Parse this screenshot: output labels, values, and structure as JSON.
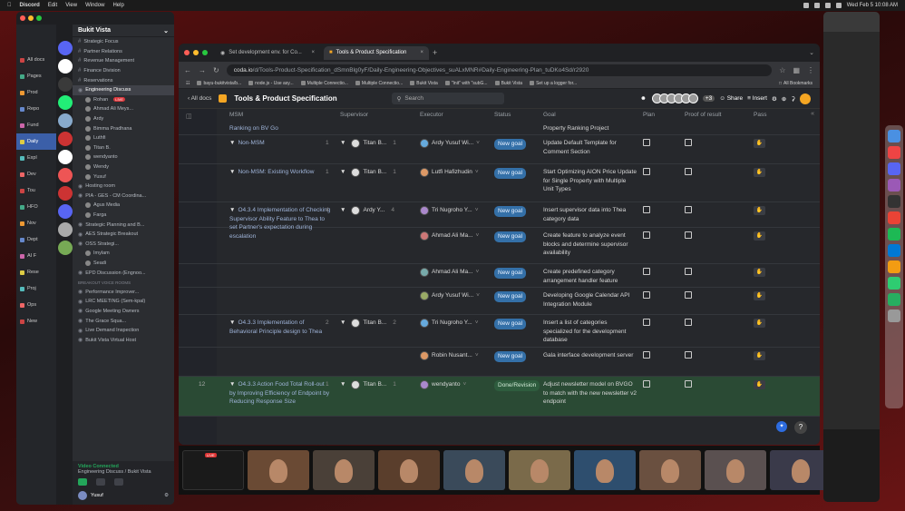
{
  "menubar": {
    "app": "Discord",
    "items": [
      "Edit",
      "View",
      "Window",
      "Help"
    ],
    "clock": "Wed Feb 5 10:08 AM"
  },
  "discord": {
    "server_name": "Bukit Vista",
    "docnav": [
      "All docs",
      "Pages",
      "Prod",
      "Repo",
      "Fund",
      "Daily",
      "Expl",
      "Dev",
      "Tou",
      "HFO",
      "Nov",
      "Dept",
      "AI F",
      "Rese",
      "Proj",
      "Ops",
      "New"
    ],
    "channels": [
      {
        "name": "Strategic Focus",
        "kind": "text"
      },
      {
        "name": "Partner Relations",
        "kind": "text"
      },
      {
        "name": "Revenue Management",
        "kind": "text"
      },
      {
        "name": "Finance Division",
        "kind": "text"
      },
      {
        "name": "Reservations",
        "kind": "text"
      },
      {
        "name": "Engineering Discuss",
        "kind": "voice",
        "active": true
      },
      {
        "name": "Rohan",
        "kind": "user",
        "badge": "LIVE"
      },
      {
        "name": "Ahmad Ali Meys...",
        "kind": "user"
      },
      {
        "name": "Ardy",
        "kind": "user"
      },
      {
        "name": "Bimma Pradhana",
        "kind": "user"
      },
      {
        "name": "Luthfi",
        "kind": "user"
      },
      {
        "name": "Titan B.",
        "kind": "user"
      },
      {
        "name": "wendyanto",
        "kind": "user"
      },
      {
        "name": "Wendy",
        "kind": "user"
      },
      {
        "name": "Yusuf",
        "kind": "user"
      },
      {
        "name": "Hosting room",
        "kind": "voice"
      },
      {
        "name": "PIA - GES - CM Coordina...",
        "kind": "voice"
      },
      {
        "name": "Agus Media",
        "kind": "user"
      },
      {
        "name": "Farga",
        "kind": "user"
      },
      {
        "name": "Strategic Planning and B...",
        "kind": "voice"
      },
      {
        "name": "AES Strategic Breakout",
        "kind": "voice"
      },
      {
        "name": "OSS Strategi...",
        "kind": "voice"
      },
      {
        "name": "Imylam",
        "kind": "user"
      },
      {
        "name": "Seadi",
        "kind": "user"
      },
      {
        "name": "EPD Discussion (Engnoo...",
        "kind": "voice"
      },
      {
        "name": "BREAKOUT VOICE ROOMS",
        "kind": "category"
      },
      {
        "name": "Performance Improver...",
        "kind": "voice"
      },
      {
        "name": "LRC MEETING (Sem-kpal)",
        "kind": "voice"
      },
      {
        "name": "Google Meeting Owners",
        "kind": "voice"
      },
      {
        "name": "The Grace Squa...",
        "kind": "voice"
      },
      {
        "name": "Live Demand Inspection",
        "kind": "voice"
      },
      {
        "name": "Bukit Vista Virtual Host",
        "kind": "voice"
      }
    ],
    "voice_status": "Video Connected",
    "voice_sub": "Engineering Discuss / Bukit Vista",
    "user": "Yusuf"
  },
  "browser": {
    "tabs": [
      {
        "title": "Set development env. for Co...",
        "active": false
      },
      {
        "title": "Tools & Product Specification",
        "active": true
      }
    ],
    "url_host": "coda.io",
    "url_path": "/d/Tools-Product-Specification_dSmnBlg0yF/Daily-Engineering-Objectives_suALxMNR#Daily-Engineering-Plan_tuDKo4Sd/r2920",
    "bookmarks": [
      "bayu-bukitvista/b...",
      "node.js - Use asy...",
      "Multiple Connectio...",
      "Multiple Connectio...",
      "Bukit Vista",
      "\"Init\" with \"subG...",
      "Bukit Vista",
      "Set up a logger for..."
    ],
    "all_bookmarks": "All Bookmarks"
  },
  "coda": {
    "all_docs": "All docs",
    "doc_title": "Tools & Product Specification",
    "search_placeholder": "Search",
    "share_label": "Share",
    "insert_label": "Insert",
    "extra_count": "+3",
    "columns": [
      "MSM",
      "Supervisor",
      "Executor",
      "Status",
      "Goal",
      "Plan",
      "Proof of result",
      "Pass"
    ],
    "rows": [
      {
        "msm": "Ranking on BV Go",
        "msm_count": "",
        "supervisor": "",
        "sup_count": "",
        "executor": "",
        "status": "",
        "goal": "Property Ranking Project",
        "h": 16,
        "partial": true
      },
      {
        "msm": "Non-MSM",
        "msm_count": "1",
        "supervisor": "Titan B...",
        "sup_count": "1",
        "executor": "Ardy Yusuf Wi...",
        "status": "New goal",
        "goal": "Update Default Template for Comment Section",
        "h": 32
      },
      {
        "msm": "Non-MSM: Existing Workflow",
        "msm_count": "1",
        "supervisor": "Titan B...",
        "sup_count": "1",
        "executor": "Lutfi Hafizhudin",
        "status": "New goal",
        "goal": "Start Optimizing AION Price Update for Single Property with Multiple Unit Types",
        "h": 42
      },
      {
        "msm": "O4.3.4 Implementation of Checking Supervisor Ability Feature to Thea to set Partner's expectation during escalation",
        "msm_count": "4",
        "supervisor": "Ardy Y...",
        "sup_count": "4",
        "executor": "Tri Nugroho Y...",
        "status": "New goal",
        "goal": "Insert supervisor data into Thea category data",
        "h": 28
      },
      {
        "msm": "",
        "msm_count": "",
        "supervisor": "",
        "sup_count": "",
        "executor": "Ahmad Ali Ma...",
        "status": "New goal",
        "goal": "Create feature to analyze event blocks and determine supervisor availability",
        "h": 40
      },
      {
        "msm": "",
        "msm_count": "",
        "supervisor": "",
        "sup_count": "",
        "executor": "Ahmad Ali Ma...",
        "status": "New goal",
        "goal": "Create predefined category arrangement handler feature",
        "h": 26
      },
      {
        "msm": "",
        "msm_count": "",
        "supervisor": "",
        "sup_count": "",
        "executor": "Ardy Yusuf Wi...",
        "status": "New goal",
        "goal": "Developing Google Calendar API Integration Module",
        "h": 30
      },
      {
        "msm": "O4.3.3 Implementation of Behavioral Principle design to Thea",
        "msm_count": "2",
        "supervisor": "Titan B...",
        "sup_count": "2",
        "executor": "Tri Nugroho Y...",
        "status": "New goal",
        "goal": "Insert a list of categories specialized for the development database",
        "h": 36
      },
      {
        "msm": "",
        "msm_count": "",
        "supervisor": "",
        "sup_count": "",
        "executor": "Robin Nusant...",
        "status": "New goal",
        "goal": "Gala interface development server",
        "h": 32
      },
      {
        "msm": "O4.3.3 Action Food Total Roll-out by Improving Efficiency of Endpoint by Reducing Response Size",
        "msm_count": "1",
        "supervisor": "Titan B...",
        "sup_count": "1",
        "executor": "wendyanto",
        "status": "Done/Revision",
        "goal": "Adjust newsletter model on BVGO to match with the new newsletter v2 endpoint",
        "h": 44,
        "highlight": true,
        "row_num": "12"
      }
    ]
  },
  "zoom": {
    "rec_label": "LIVE",
    "participants": 10
  },
  "colors": {
    "accent": "#3470a8",
    "discord_bg": "#2b2d31",
    "coda_bg": "#26282c",
    "highlight_row": "#2a4a34"
  }
}
